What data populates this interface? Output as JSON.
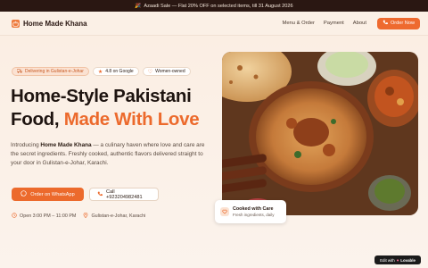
{
  "banner": {
    "icon": "party-popper-icon",
    "text": "Azaadi Sale — Flat 20% OFF on selected items, till 31 August 2026"
  },
  "nav": {
    "brand": "Home Made Khana",
    "links": [
      "Menu & Order",
      "Payment",
      "About"
    ],
    "order_button": "Order Now"
  },
  "hero": {
    "badges": [
      {
        "icon": "truck-icon",
        "label": "Delivering in Gulistan-e-Johar"
      },
      {
        "icon": "star-icon",
        "label": "4.8 on Google"
      },
      {
        "icon": "heart-icon",
        "label": "Women-owned"
      }
    ],
    "headline_part1": "Home-Style Pakistani",
    "headline_part2": "Food,",
    "headline_accent": "Made With Love",
    "desc_intro": "Introducing ",
    "desc_brand": "Home Made Khana",
    "desc_rest": " — a culinary haven where love and care are the secret ingredients. Freshly cooked, authentic flavors delivered straight to your door in Gulistan-e-Johar, Karachi.",
    "whatsapp_button": "Order on WhatsApp",
    "call_button": "Call +923204982481",
    "hours": "Open 3:00 PM – 11:00 PM",
    "location": "Gulistan-e-Johar, Karachi"
  },
  "card": {
    "title": "Cooked with Care",
    "subtitle": "Fresh ingredients, daily"
  },
  "lovable": {
    "prefix": "Edit with",
    "brand": "Lovable"
  },
  "colors": {
    "accent": "#ec6a2c",
    "banner_bg": "#2a1712",
    "page_bg": "#fbf1e8"
  }
}
